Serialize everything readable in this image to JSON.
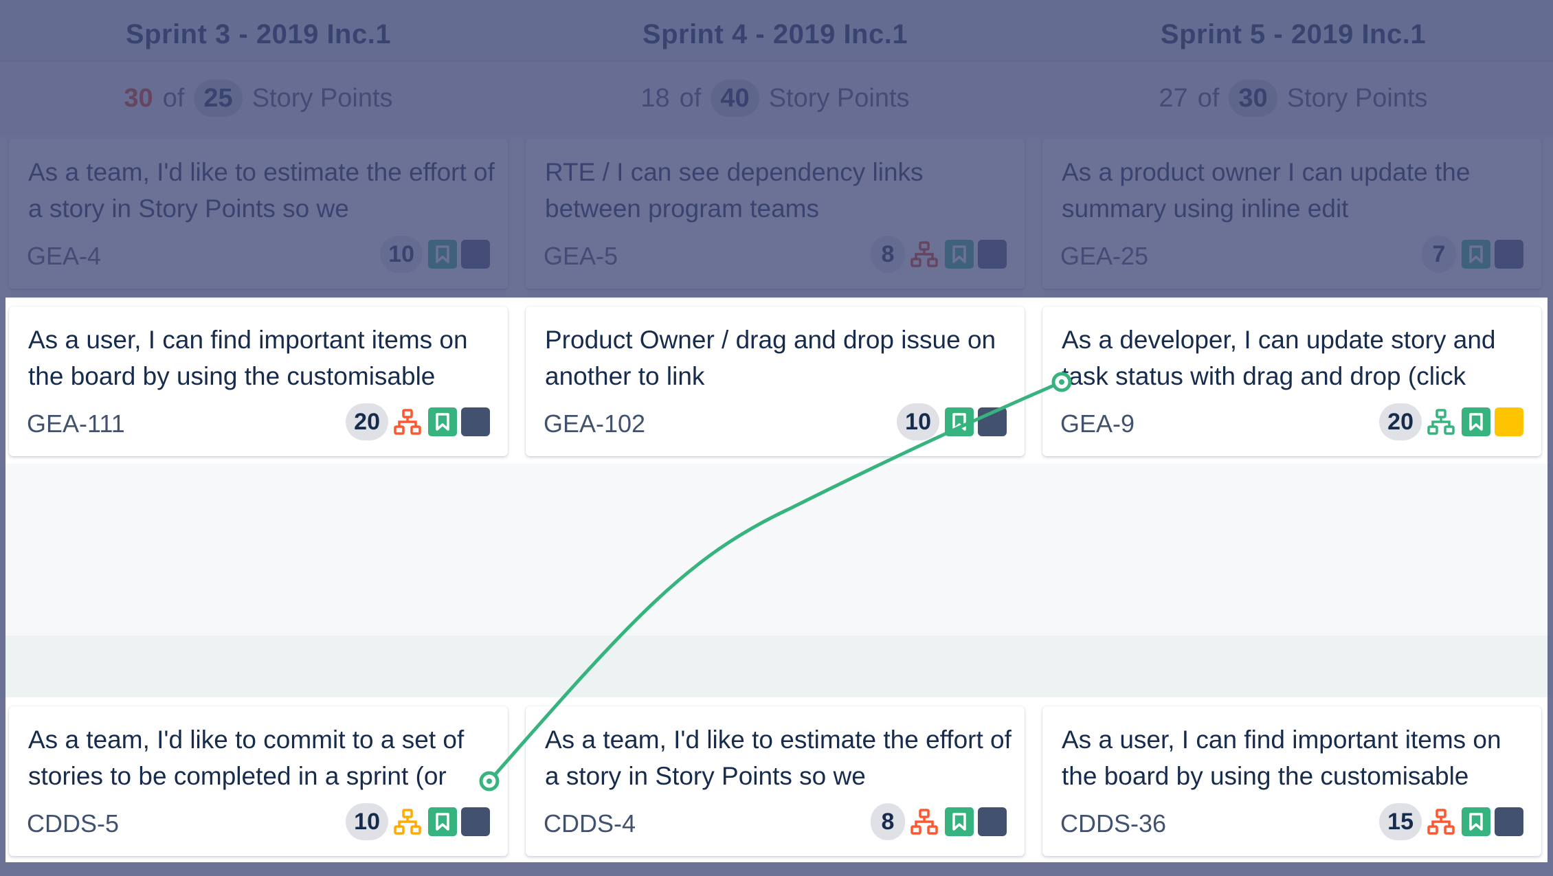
{
  "sprints": [
    {
      "title": "Sprint 3 - 2019 Inc.1",
      "loaded": "30",
      "loaded_over": true,
      "of": "of",
      "capacity": "25",
      "unit": "Story Points"
    },
    {
      "title": "Sprint 4 - 2019 Inc.1",
      "loaded": "18",
      "loaded_over": false,
      "of": "of",
      "capacity": "40",
      "unit": "Story Points"
    },
    {
      "title": "Sprint 5 - 2019 Inc.1",
      "loaded": "27",
      "loaded_over": false,
      "of": "of",
      "capacity": "30",
      "unit": "Story Points"
    }
  ],
  "lanes": {
    "top": [
      {
        "summary": "As a team, I'd like to estimate the effort of a story in Story Points so we",
        "key": "GEA-4",
        "points": "10",
        "dependency": null,
        "type": "story-icon",
        "priority_color": "#42526e"
      },
      {
        "summary": "RTE / I can see dependency links between program teams",
        "key": "GEA-5",
        "points": "8",
        "dependency": "#de350b",
        "type": "story-icon",
        "priority_color": "#42526e"
      },
      {
        "summary": "As a product owner I can update the summary using inline edit",
        "key": "GEA-25",
        "points": "7",
        "dependency": null,
        "type": "story-icon",
        "priority_color": "#42526e"
      }
    ],
    "middle": [
      {
        "summary": "As a user, I can find important items on the board by using the customisable",
        "key": "GEA-111",
        "points": "20",
        "dependency": "#ff5630",
        "type": "story-icon",
        "priority_color": "#42526e"
      },
      {
        "summary": "Product Owner / drag and drop issue on another to link",
        "key": "GEA-102",
        "points": "10",
        "dependency": null,
        "type": "story-icon",
        "priority_color": "#42526e"
      },
      {
        "summary": "As a developer, I can update story and task status with drag and drop (click",
        "key": "GEA-9",
        "points": "20",
        "dependency": "#36b37e",
        "type": "story-icon",
        "priority_color": "#ffc400"
      }
    ],
    "bottom": [
      {
        "summary": "As a team, I'd like to commit to a set of stories to be completed in a sprint (or",
        "key": "CDDS-5",
        "points": "10",
        "dependency": "#ffab00",
        "type": "story-icon",
        "priority_color": "#42526e"
      },
      {
        "summary": "As a team, I'd like to estimate the effort of a story in Story Points so we",
        "key": "CDDS-4",
        "points": "8",
        "dependency": "#ff5630",
        "type": "story-icon",
        "priority_color": "#42526e"
      },
      {
        "summary": "As a user, I can find important items on the board by using the customisable",
        "key": "CDDS-36",
        "points": "15",
        "dependency": "#ff5630",
        "type": "story-icon",
        "priority_color": "#42526e"
      }
    ]
  },
  "link": {
    "color": "#36b37e",
    "from": "CDDS-5",
    "to": "GEA-9"
  }
}
